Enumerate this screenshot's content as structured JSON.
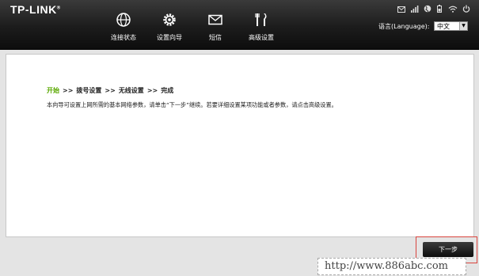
{
  "brand": {
    "name": "TP-LINK",
    "mark": "®"
  },
  "nav": [
    {
      "label": "连接状态",
      "icon": "globe-icon"
    },
    {
      "label": "设置向导",
      "icon": "gear-icon"
    },
    {
      "label": "短信",
      "icon": "envelope-icon"
    },
    {
      "label": "高级设置",
      "icon": "tools-icon"
    }
  ],
  "status_icons": [
    "mail-icon",
    "signal-icon",
    "globe-status-icon",
    "battery-icon",
    "wifi-icon",
    "power-icon"
  ],
  "language": {
    "label": "语言(Language):",
    "selected": "中文"
  },
  "wizard": {
    "steps": [
      "开始",
      "拨号设置",
      "无线设置",
      "完成"
    ],
    "separator": ">>",
    "description": "本向导可设置上网所需的基本网络参数，请单击“下一步”继续。若要详细设置某项功能或者参数，请点击高级设置。"
  },
  "next_button": {
    "label": "下一步"
  },
  "watermark": "http://www.886abc.com",
  "colors": {
    "accent_green": "#5aa800",
    "header_dark": "#1c1c1c",
    "highlight_red": "#d9443e"
  }
}
